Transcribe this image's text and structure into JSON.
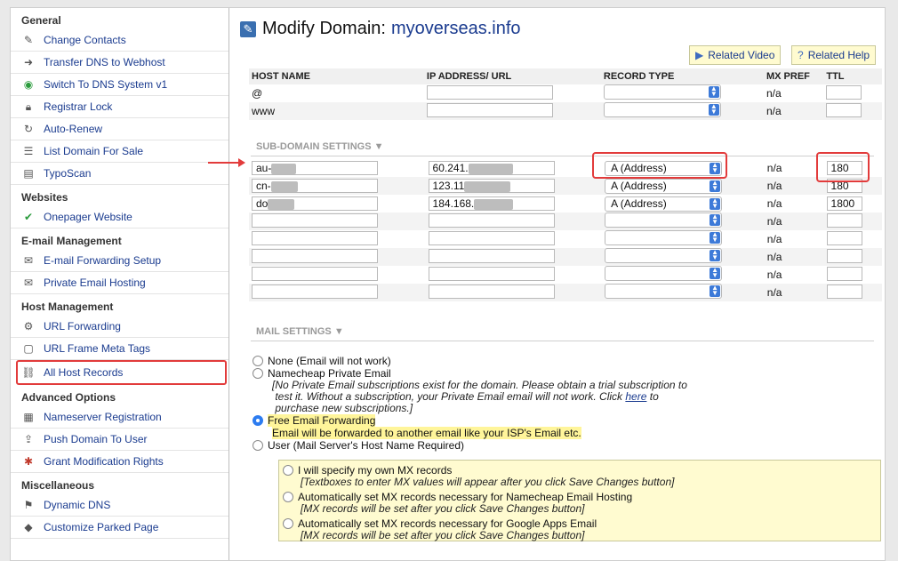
{
  "sidebar": {
    "general_title": "General",
    "general_items": [
      {
        "label": "Change Contacts",
        "icon": "contacts-icon"
      },
      {
        "label": "Transfer DNS to Webhost",
        "icon": "transfer-icon"
      },
      {
        "label": "Switch To DNS System v1",
        "icon": "switch-icon"
      },
      {
        "label": "Registrar Lock",
        "icon": "lock-icon"
      },
      {
        "label": "Auto-Renew",
        "icon": "renew-icon"
      },
      {
        "label": "List Domain For Sale",
        "icon": "list-icon"
      },
      {
        "label": "TypoScan",
        "icon": "typoscan-icon"
      }
    ],
    "websites_title": "Websites",
    "websites_items": [
      {
        "label": "Onepager Website",
        "icon": "check-icon"
      }
    ],
    "email_title": "E-mail Management",
    "email_items": [
      {
        "label": "E-mail Forwarding Setup",
        "icon": "mail-forward-icon"
      },
      {
        "label": "Private Email Hosting",
        "icon": "mail-icon"
      }
    ],
    "host_title": "Host Management",
    "host_items": [
      {
        "label": "URL Forwarding",
        "icon": "url-forward-icon"
      },
      {
        "label": "URL Frame Meta Tags",
        "icon": "frame-icon"
      },
      {
        "label": "All Host Records",
        "icon": "host-records-icon"
      }
    ],
    "advanced_title": "Advanced Options",
    "advanced_items": [
      {
        "label": "Nameserver Registration",
        "icon": "nameserver-icon"
      },
      {
        "label": "Push Domain To User",
        "icon": "push-icon"
      },
      {
        "label": "Grant Modification Rights",
        "icon": "grant-icon"
      }
    ],
    "misc_title": "Miscellaneous",
    "misc_items": [
      {
        "label": "Dynamic DNS",
        "icon": "dns-icon"
      },
      {
        "label": "Customize Parked Page",
        "icon": "parked-icon"
      }
    ]
  },
  "header": {
    "title_prefix": "Modify Domain:",
    "domain": "myoverseas.info",
    "related_video": "Related Video",
    "related_help": "Related Help"
  },
  "columns": [
    "HOST NAME",
    "IP ADDRESS/ URL",
    "RECORD TYPE",
    "MX PREF",
    "TTL"
  ],
  "main_records": [
    {
      "host": "@",
      "ip": "",
      "type": "",
      "mx": "n/a",
      "ttl": ""
    },
    {
      "host": "www",
      "ip": "",
      "type": "",
      "mx": "n/a",
      "ttl": ""
    }
  ],
  "subdomain_title": "SUB-DOMAIN SETTINGS",
  "sub_records": [
    {
      "host": "au-",
      "ip": "60.241.",
      "type": "A (Address)",
      "mx": "n/a",
      "ttl": "180"
    },
    {
      "host": "cn-",
      "ip": "123.11",
      "type": "A (Address)",
      "mx": "n/a",
      "ttl": "180"
    },
    {
      "host": "do",
      "ip": "184.168.",
      "type": "A (Address)",
      "mx": "n/a",
      "ttl": "1800"
    },
    {
      "host": "",
      "ip": "",
      "type": "",
      "mx": "n/a",
      "ttl": ""
    },
    {
      "host": "",
      "ip": "",
      "type": "",
      "mx": "n/a",
      "ttl": ""
    },
    {
      "host": "",
      "ip": "",
      "type": "",
      "mx": "n/a",
      "ttl": ""
    },
    {
      "host": "",
      "ip": "",
      "type": "",
      "mx": "n/a",
      "ttl": ""
    },
    {
      "host": "",
      "ip": "",
      "type": "",
      "mx": "n/a",
      "ttl": ""
    }
  ],
  "mail_title": "MAIL SETTINGS",
  "mail": {
    "none": "None (Email will not work)",
    "private": "Namecheap Private Email",
    "private_note_1": "[No Private Email subscriptions exist for the domain. Please obtain a trial subscription to",
    "private_note_2a": "test it. Without a subscription, your Private Email email will not work. Click",
    "private_note_link": "here",
    "private_note_2b": "to",
    "private_note_3": "purchase new subscriptions.]",
    "free": "Free Email Forwarding",
    "free_note": "Email will be forwarded to another email like your ISP's Email etc.",
    "user": "User (Mail Server's Host Name Required)",
    "mx_own": "I will specify my own MX records",
    "mx_own_note": "[Textboxes to enter MX values will appear after you click Save Changes button]",
    "mx_nc": "Automatically set MX records necessary for Namecheap Email Hosting",
    "mx_nc_note": "[MX records will be set after you click Save Changes button]",
    "mx_google": "Automatically set MX records necessary for Google Apps Email",
    "mx_google_note": "[MX records will be set after you click Save Changes button]"
  },
  "colors": {
    "accent": "#1a3b8f",
    "highlight": "#e23b3b",
    "radio": "#2d7cf0",
    "note_bg": "#fff59a"
  }
}
